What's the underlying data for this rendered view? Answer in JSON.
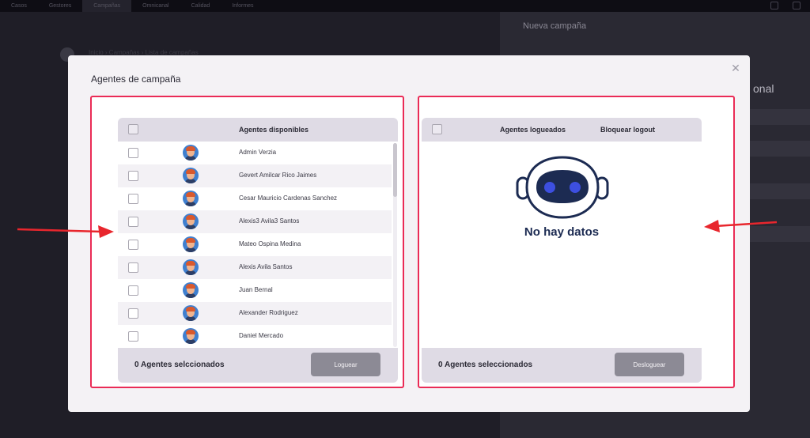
{
  "topnav": {
    "tabs": [
      "Casos",
      "Gestores",
      "Campañas",
      "Omnicanal",
      "Calidad",
      "Informes"
    ],
    "active_index": 2
  },
  "background": {
    "right_title": "Nueva campaña",
    "right_subtitle": "onal",
    "crumbs": "Inicio  ›  Campañas  ›  Lista de campañas"
  },
  "modal": {
    "title": "Agentes de campaña",
    "close_icon": "close-icon"
  },
  "available_panel": {
    "header": "Agentes disponibles",
    "agents": [
      "Admin Verzia",
      "Gevert Amilcar Rico Jaimes",
      "Cesar Mauricio Cardenas Sanchez",
      "Alexis3 Avila3 Santos",
      "Mateo Ospina Medina",
      "Alexis Avila Santos",
      "Juan Bernal",
      "Alexander Rodriguez",
      "Daniel Mercado"
    ],
    "selected_count": "0 Agentes selccionados",
    "button": "Loguear"
  },
  "logged_panel": {
    "header_agents": "Agentes logueados",
    "header_block": "Bloquear logout",
    "empty_text": "No hay datos",
    "empty_icon": "robot-icon",
    "selected_count": "0 Agentes seleccionados",
    "button": "Desloguear"
  },
  "colors": {
    "highlight": "#ea2b56",
    "arrow": "#e8262d",
    "robot_eyes": "#3d4fe0",
    "button": "#8c8a95"
  }
}
